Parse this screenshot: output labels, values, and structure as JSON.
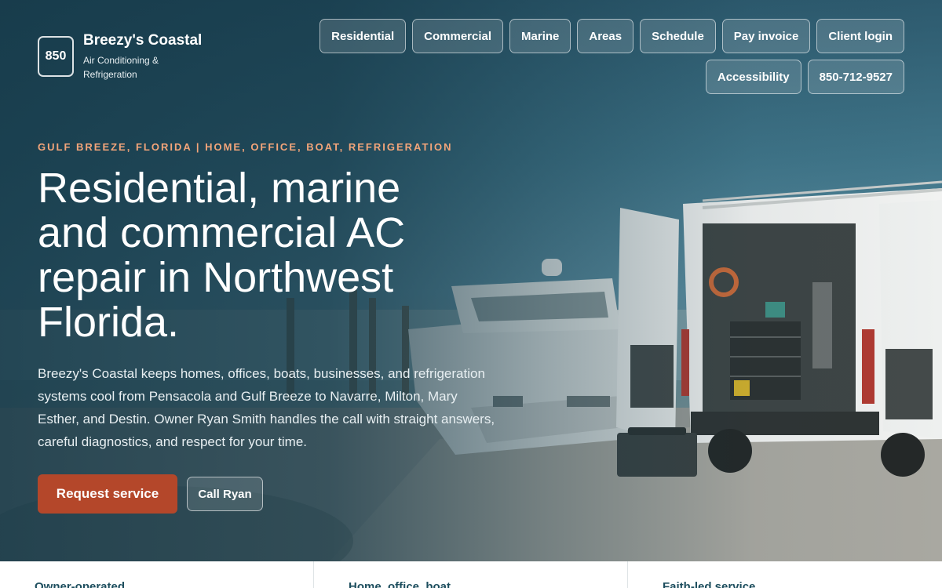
{
  "brand": {
    "badge": "850",
    "name": "Breezy's Coastal",
    "subtitle": "Air Conditioning & Refrigeration"
  },
  "nav": {
    "items": [
      {
        "label": "Residential"
      },
      {
        "label": "Commercial"
      },
      {
        "label": "Marine"
      },
      {
        "label": "Areas"
      },
      {
        "label": "Schedule"
      },
      {
        "label": "Pay invoice"
      },
      {
        "label": "Client login"
      },
      {
        "label": "Accessibility"
      },
      {
        "label": "850-712-9527"
      }
    ]
  },
  "hero": {
    "eyebrow": "GULF BREEZE, FLORIDA | HOME, OFFICE, BOAT, REFRIGERATION",
    "headline": "Residential, marine and commercial AC repair in Northwest Florida.",
    "intro": "Breezy's Coastal keeps homes, offices, boats, businesses, and refrigeration systems cool from Pensacola and Gulf Breeze to Navarre, Milton, Mary Esther, and Destin. Owner Ryan Smith handles the call with straight answers, careful diagnostics, and respect for your time.",
    "primary_cta": "Request service",
    "secondary_cta": "Call Ryan"
  },
  "features": [
    {
      "title": "Owner-operated"
    },
    {
      "title": "Home, office, boat"
    },
    {
      "title": "Faith-led service"
    }
  ],
  "colors": {
    "accent": "#b4472a",
    "eyebrow": "#f3a57a",
    "heading_dark": "#1d4e5e"
  }
}
